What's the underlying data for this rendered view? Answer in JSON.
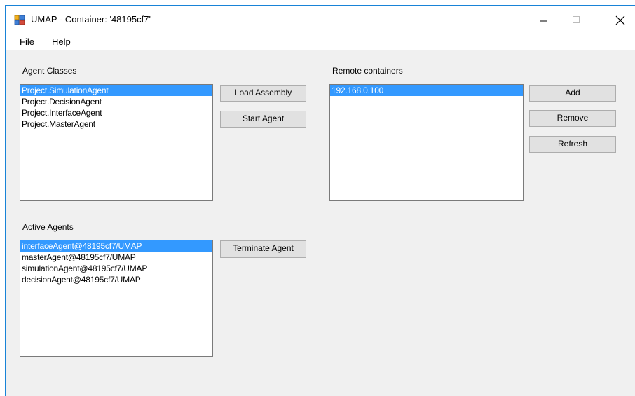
{
  "window": {
    "title": "UMAP - Container: '48195cf7'"
  },
  "menu": [
    {
      "label": "File"
    },
    {
      "label": "Help"
    }
  ],
  "agent_classes": {
    "label": "Agent Classes",
    "items": [
      "Project.SimulationAgent",
      "Project.DecisionAgent",
      "Project.InterfaceAgent",
      "Project.MasterAgent"
    ],
    "selected_index": 0
  },
  "buttons": {
    "load_assembly": "Load Assembly",
    "start_agent": "Start Agent",
    "terminate_agent": "Terminate Agent",
    "add": "Add",
    "remove": "Remove",
    "refresh": "Refresh"
  },
  "remote_containers": {
    "label": "Remote containers",
    "items": [
      "192.168.0.100"
    ],
    "selected_index": 0
  },
  "active_agents": {
    "label": "Active Agents",
    "items": [
      "interfaceAgent@48195cf7/UMAP",
      "masterAgent@48195cf7/UMAP",
      "simulationAgent@48195cf7/UMAP",
      "decisionAgent@48195cf7/UMAP"
    ],
    "selected_index": 0
  },
  "colors": {
    "selection": "#3399ff",
    "window_border": "#1883d7",
    "face": "#f0f0f0"
  },
  "icons": {
    "app": "app-icon",
    "minimize": "minimize-icon",
    "maximize": "maximize-icon",
    "close": "close-icon"
  }
}
